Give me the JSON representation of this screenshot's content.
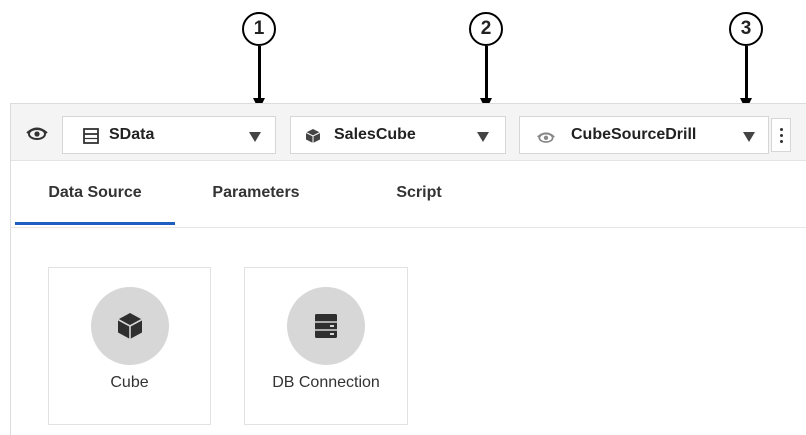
{
  "callouts": [
    {
      "number": "1"
    },
    {
      "number": "2"
    },
    {
      "number": "3"
    }
  ],
  "toolbar": {
    "left_icon": "eye-icon",
    "datasource_dropdown": {
      "label": "SData",
      "icon": "table-icon"
    },
    "cube_dropdown": {
      "label": "SalesCube",
      "icon": "cube-icon"
    },
    "source_dropdown": {
      "label": "CubeSourceDrill",
      "icon": "eye-icon"
    },
    "more_icon": "more-vertical-icon"
  },
  "tabs": [
    {
      "label": "Data Source",
      "active": true
    },
    {
      "label": "Parameters",
      "active": false
    },
    {
      "label": "Script",
      "active": false
    }
  ],
  "cards": [
    {
      "label": "Cube",
      "icon": "cube-icon"
    },
    {
      "label": "DB Connection",
      "icon": "database-icon"
    }
  ],
  "colors": {
    "accent": "#1d5fc1",
    "toolbar_bg": "#f4f4f4",
    "icon_circle": "#d7d7d7"
  }
}
